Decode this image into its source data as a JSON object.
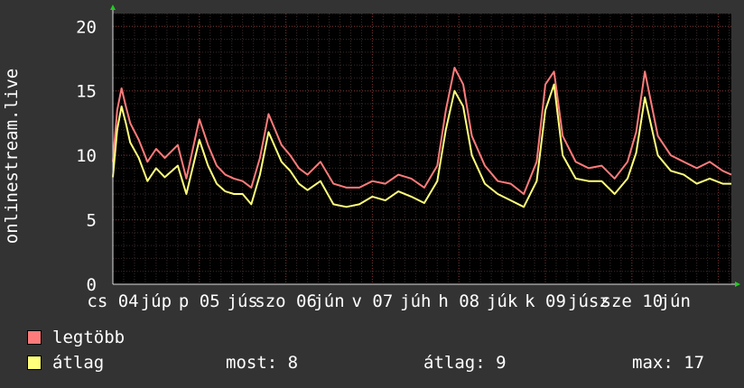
{
  "chart_data": {
    "type": "line",
    "ylabel": "onlinestream.live",
    "ylim": [
      0,
      21
    ],
    "yticks": [
      0,
      5,
      10,
      15,
      20
    ],
    "grid": true,
    "xlim": [
      0,
      7.15
    ],
    "xtick_labels": [
      {
        "x": 0,
        "label": "cs 04"
      },
      {
        "x": 0.5,
        "label": "júp"
      },
      {
        "x": 1,
        "label": "p 05"
      },
      {
        "x": 1.5,
        "label": "jús"
      },
      {
        "x": 2,
        "label": "szo 06"
      },
      {
        "x": 2.5,
        "label": "jún"
      },
      {
        "x": 3,
        "label": "v 07"
      },
      {
        "x": 3.5,
        "label": "júh"
      },
      {
        "x": 4,
        "label": "h 08"
      },
      {
        "x": 4.5,
        "label": "júk"
      },
      {
        "x": 5,
        "label": "k 09"
      },
      {
        "x": 5.5,
        "label": "júsz"
      },
      {
        "x": 6,
        "label": "sze 10"
      },
      {
        "x": 6.5,
        "label": "jún"
      }
    ],
    "series": [
      {
        "name": "legtöbb",
        "color": "#ff7b7b",
        "x": [
          0,
          0.05,
          0.1,
          0.15,
          0.2,
          0.3,
          0.4,
          0.5,
          0.6,
          0.75,
          0.85,
          1.0,
          1.1,
          1.2,
          1.3,
          1.4,
          1.5,
          1.6,
          1.7,
          1.8,
          1.95,
          2.05,
          2.15,
          2.25,
          2.4,
          2.55,
          2.7,
          2.85,
          3.0,
          3.15,
          3.3,
          3.45,
          3.6,
          3.75,
          3.85,
          3.95,
          4.05,
          4.15,
          4.3,
          4.45,
          4.6,
          4.75,
          4.9,
          5.0,
          5.1,
          5.2,
          5.35,
          5.5,
          5.65,
          5.8,
          5.95,
          6.05,
          6.15,
          6.3,
          6.45,
          6.6,
          6.75,
          6.9,
          7.05,
          7.15
        ],
        "values": [
          9.5,
          13.5,
          15.2,
          13.8,
          12.5,
          11.2,
          9.5,
          10.5,
          9.8,
          10.8,
          8.2,
          12.8,
          10.8,
          9.2,
          8.5,
          8.2,
          8.0,
          7.5,
          9.8,
          13.2,
          10.8,
          10.0,
          9.0,
          8.5,
          9.5,
          7.8,
          7.5,
          7.5,
          8.0,
          7.8,
          8.5,
          8.2,
          7.5,
          9.2,
          13.5,
          16.8,
          15.5,
          11.5,
          9.2,
          8.0,
          7.8,
          7.0,
          9.5,
          15.5,
          16.5,
          11.5,
          9.5,
          9.0,
          9.2,
          8.2,
          9.5,
          11.8,
          16.5,
          11.5,
          10.0,
          9.5,
          9.0,
          9.5,
          8.8,
          8.5
        ]
      },
      {
        "name": "átlag",
        "color": "#ffff7b",
        "x": [
          0,
          0.05,
          0.1,
          0.15,
          0.2,
          0.3,
          0.4,
          0.5,
          0.6,
          0.75,
          0.85,
          1.0,
          1.1,
          1.2,
          1.3,
          1.4,
          1.5,
          1.6,
          1.7,
          1.8,
          1.95,
          2.05,
          2.15,
          2.25,
          2.4,
          2.55,
          2.7,
          2.85,
          3.0,
          3.15,
          3.3,
          3.45,
          3.6,
          3.75,
          3.85,
          3.95,
          4.05,
          4.15,
          4.3,
          4.45,
          4.6,
          4.75,
          4.9,
          5.0,
          5.1,
          5.2,
          5.35,
          5.5,
          5.65,
          5.8,
          5.95,
          6.05,
          6.15,
          6.3,
          6.45,
          6.6,
          6.75,
          6.9,
          7.05,
          7.15
        ],
        "values": [
          8.3,
          12.0,
          13.8,
          12.5,
          11.0,
          9.8,
          8.0,
          9.0,
          8.3,
          9.2,
          7.0,
          11.2,
          9.2,
          7.8,
          7.2,
          7.0,
          7.0,
          6.2,
          8.5,
          11.8,
          9.5,
          8.8,
          7.8,
          7.3,
          8.0,
          6.2,
          6.0,
          6.2,
          6.8,
          6.5,
          7.2,
          6.8,
          6.3,
          8.0,
          12.0,
          15.0,
          13.8,
          10.0,
          7.8,
          7.0,
          6.5,
          6.0,
          8.0,
          13.5,
          15.5,
          10.0,
          8.2,
          8.0,
          8.0,
          7.0,
          8.2,
          10.2,
          14.5,
          10.0,
          8.8,
          8.5,
          7.8,
          8.2,
          7.8,
          7.8
        ]
      }
    ]
  },
  "legend": [
    {
      "label": "legtöbb",
      "color": "#ff7b7b"
    },
    {
      "label": "átlag",
      "color": "#ffff7b"
    }
  ],
  "stats": {
    "most": "most: 8",
    "atlag": "átlag: 9",
    "max": "max: 17"
  }
}
